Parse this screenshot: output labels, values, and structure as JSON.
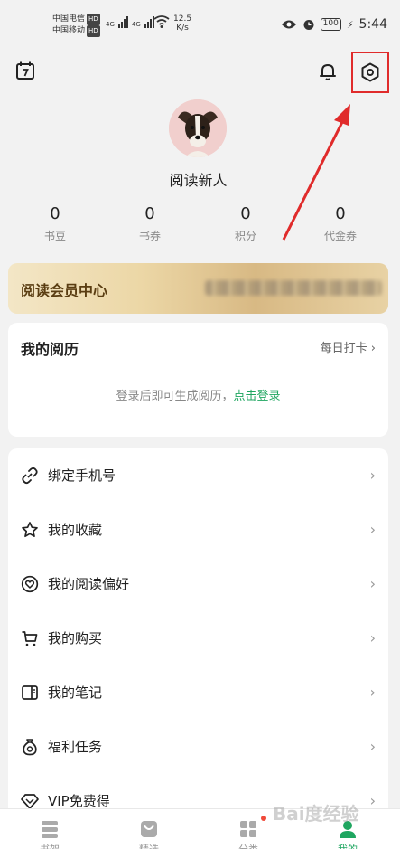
{
  "status_bar": {
    "carrier1": "中国电信",
    "carrier2": "中国移动",
    "hd_badge": "HD",
    "network1": "4G",
    "network2": "4G",
    "speed_value": "12.5",
    "speed_unit": "K/s",
    "battery": "100",
    "time": "5:44"
  },
  "profile": {
    "nickname": "阅读新人"
  },
  "stats": [
    {
      "value": "0",
      "label": "书豆"
    },
    {
      "value": "0",
      "label": "书券"
    },
    {
      "value": "0",
      "label": "积分"
    },
    {
      "value": "0",
      "label": "代金券"
    }
  ],
  "vip": {
    "title": "阅读会员中心"
  },
  "history": {
    "title": "我的阅历",
    "checkin": "每日打卡",
    "message": "登录后即可生成阅历，",
    "login_link": "点击登录"
  },
  "menu": [
    {
      "label": "绑定手机号",
      "icon": "link-icon"
    },
    {
      "label": "我的收藏",
      "icon": "star-icon"
    },
    {
      "label": "我的阅读偏好",
      "icon": "heart-icon"
    },
    {
      "label": "我的购买",
      "icon": "cart-icon"
    },
    {
      "label": "我的笔记",
      "icon": "notebook-icon"
    },
    {
      "label": "福利任务",
      "icon": "gift-bag-icon"
    },
    {
      "label": "VIP免费得",
      "icon": "diamond-icon"
    }
  ],
  "chevron": "›",
  "tabs": [
    {
      "label": "书架"
    },
    {
      "label": "精选"
    },
    {
      "label": "分类"
    },
    {
      "label": "我的"
    }
  ],
  "watermark": "Bai度经验",
  "colors": {
    "accent_green": "#1fa660",
    "annotation_red": "#e02b2b",
    "vip_gold": "#d8b984"
  }
}
